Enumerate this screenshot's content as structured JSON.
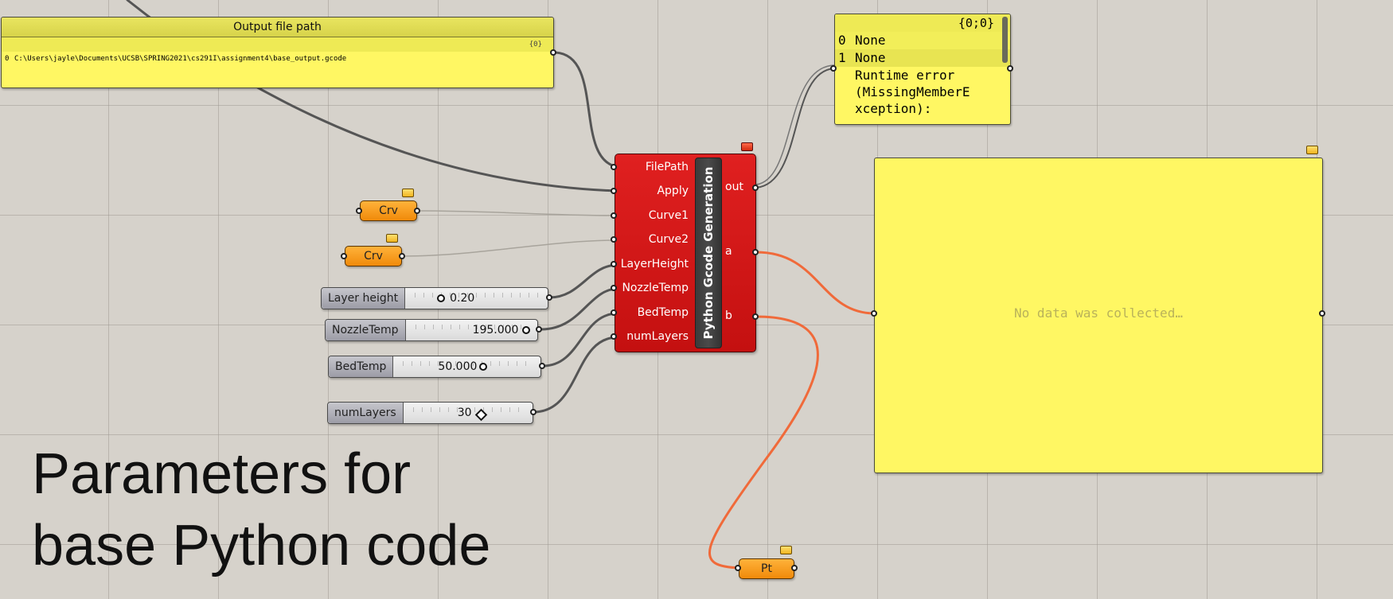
{
  "output_panel": {
    "title": "Output file path",
    "path_tag": "{0}",
    "rows": [
      {
        "index": "0",
        "value": "C:\\Users\\jayle\\Documents\\UCSB\\SPRING2021\\cs291I\\assignment4\\base_output.gcode"
      }
    ]
  },
  "result_panel": {
    "path_tag": "{0;0}",
    "rows": [
      {
        "index": "0",
        "value": "None"
      },
      {
        "index": "1",
        "value": "None"
      }
    ],
    "error_lines": [
      "Runtime error",
      "(MissingMemberE",
      "xception):"
    ]
  },
  "empty_panel": {
    "message": "No data was collected…"
  },
  "component": {
    "name": "Python Gcode Generation",
    "inputs": [
      "FilePath",
      "Apply",
      "Curve1",
      "Curve2",
      "LayerHeight",
      "NozzleTemp",
      "BedTemp",
      "numLayers"
    ],
    "outputs": [
      "out",
      "a",
      "b"
    ]
  },
  "params": {
    "crv1": "Crv",
    "crv2": "Crv",
    "pt": "Pt"
  },
  "sliders": [
    {
      "label": "Layer height",
      "value": "0.20",
      "position": 0.0
    },
    {
      "label": "NozzleTemp",
      "value": "195.000",
      "position": 1.0
    },
    {
      "label": "BedTemp",
      "value": "50.000",
      "position": 0.55
    },
    {
      "label": "numLayers",
      "value": "30",
      "position": 0.5
    }
  ],
  "caption": {
    "line1": "Parameters for",
    "line2": "base Python code"
  },
  "colors": {
    "panel": "#fff763",
    "component": "#d31515",
    "param": "#f7a022",
    "wire_dark": "#555555",
    "wire_light": "#a8a49c",
    "wire_active": "#f06a3a"
  }
}
